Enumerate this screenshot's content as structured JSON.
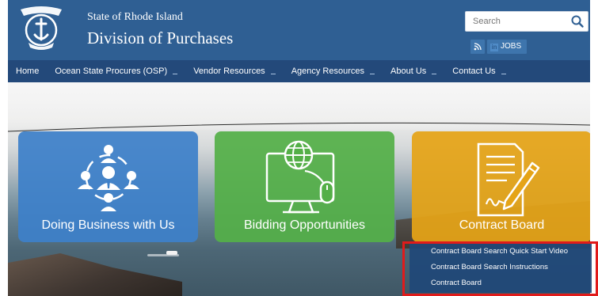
{
  "header": {
    "state_line": "State of Rhode Island",
    "division_line": "Division of Purchases",
    "seal_icon": "ri-state-seal-icon",
    "search": {
      "placeholder": "Search",
      "value": ""
    },
    "jobs_label": "JOBS",
    "jobs_in_mark": "in",
    "colors": {
      "header_bg": "#2f5f93",
      "nav_bg": "#23497a"
    }
  },
  "nav": {
    "items": [
      {
        "label": "Home",
        "has_dropdown": false
      },
      {
        "label": "Ocean State Procures (OSP)",
        "has_dropdown": true
      },
      {
        "label": "Vendor Resources",
        "has_dropdown": true
      },
      {
        "label": "Agency Resources",
        "has_dropdown": true
      },
      {
        "label": "About Us",
        "has_dropdown": true
      },
      {
        "label": "Contact Us",
        "has_dropdown": true
      }
    ]
  },
  "hero": {
    "tiles": [
      {
        "label": "Doing Business with Us",
        "icon": "people-network-icon",
        "color": "#3d80c9"
      },
      {
        "label": "Bidding Opportunities",
        "icon": "computer-globe-mouse-icon",
        "color": "#54af48"
      },
      {
        "label": "Contract Board",
        "icon": "contract-pen-icon",
        "color": "#e5a417"
      }
    ]
  },
  "dropdown": {
    "highlight_color": "#e01b1b",
    "items": [
      {
        "label": "Contract Board Search Quick Start Video"
      },
      {
        "label": "Contract Board Search Instructions"
      },
      {
        "label": "Contract Board"
      }
    ]
  }
}
